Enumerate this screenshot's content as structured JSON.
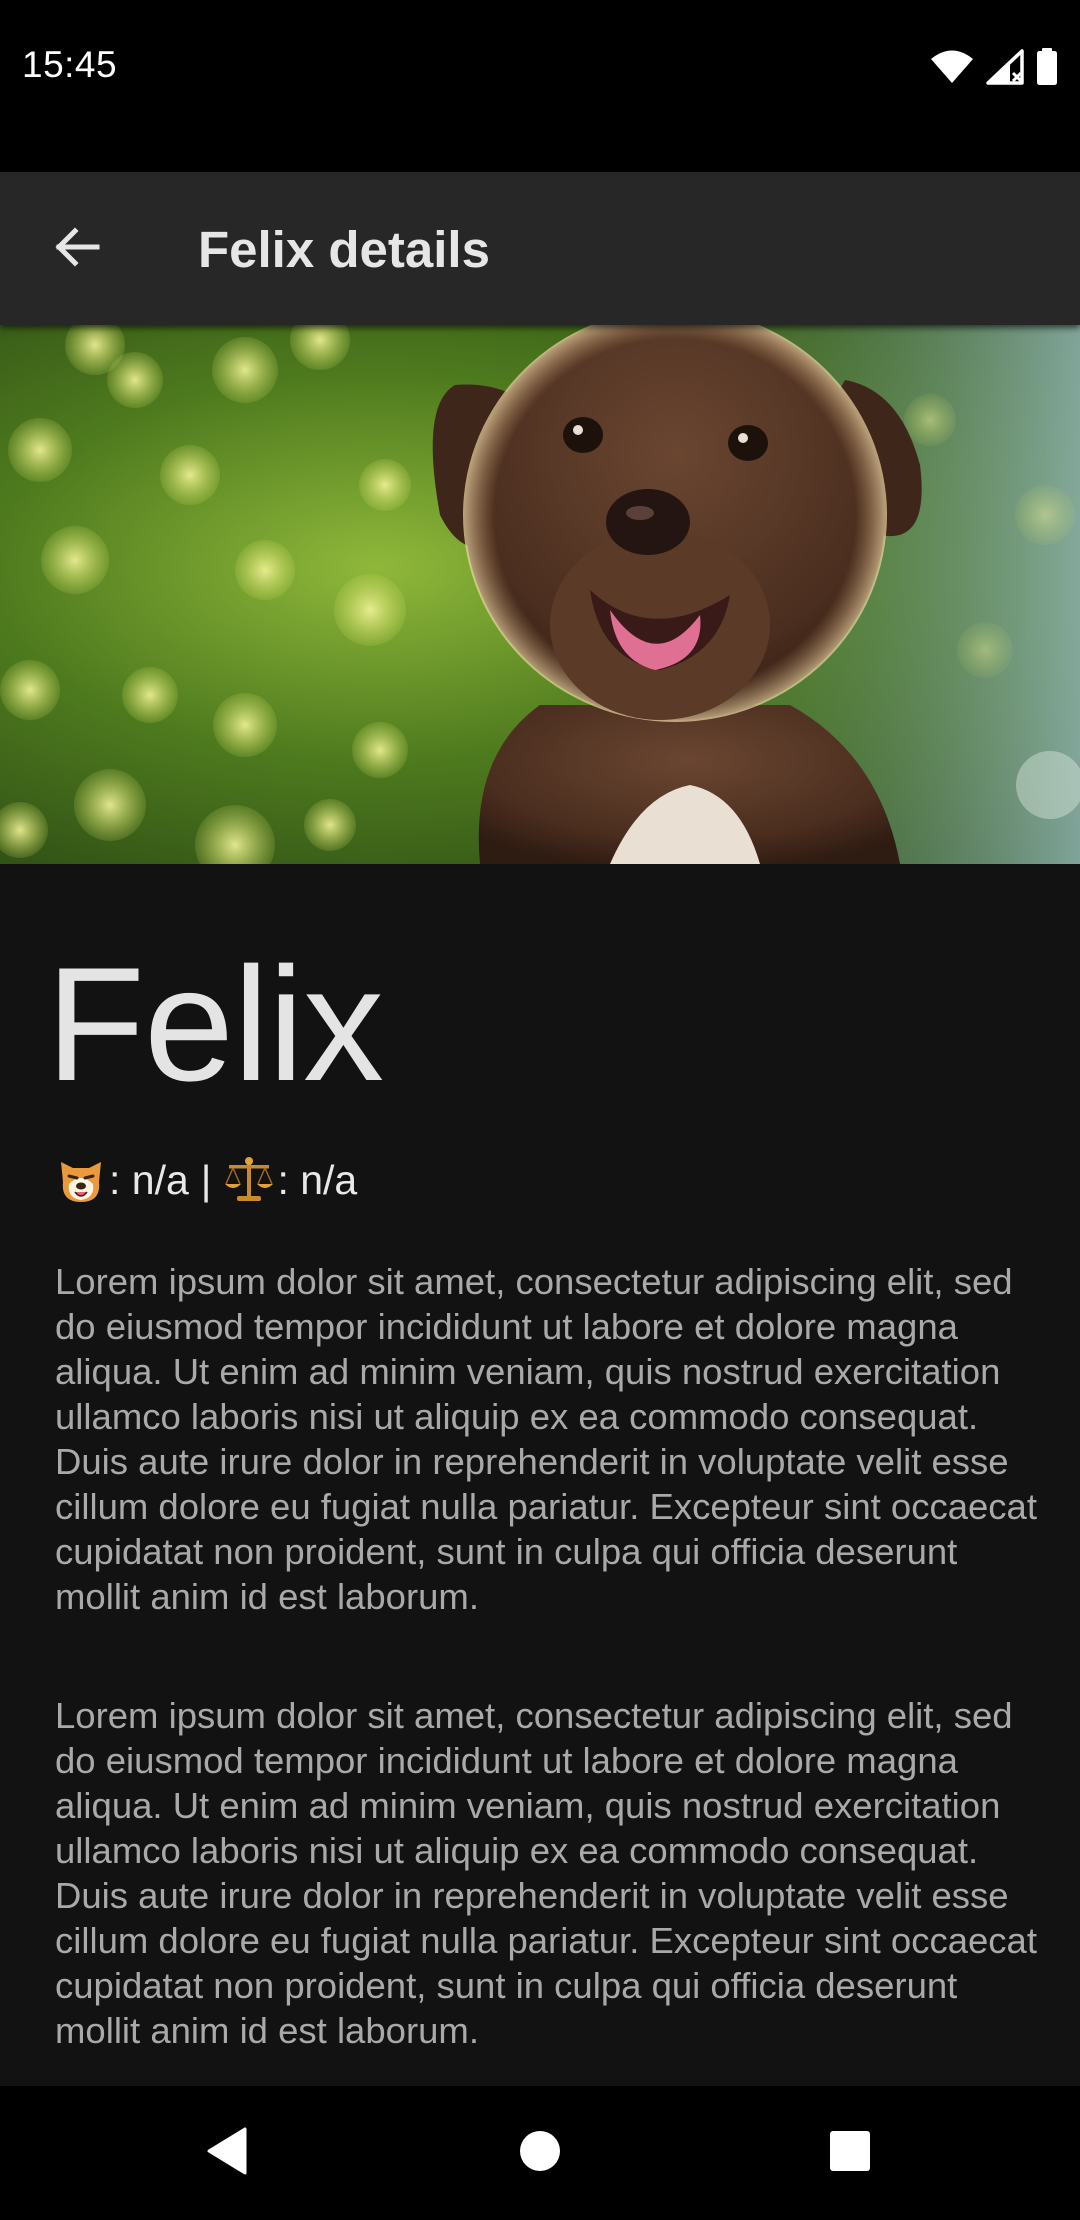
{
  "status_bar": {
    "time": "15:45",
    "icons": [
      "wifi-icon",
      "signal-icon",
      "battery-icon"
    ]
  },
  "app_bar": {
    "title": "Felix details",
    "back_icon": "arrow-left-icon"
  },
  "hero": {
    "subject": "puppy-photo"
  },
  "pet": {
    "name": "Felix",
    "age_emoji": "dog-face-icon",
    "age_value": ": n/a",
    "separator": "|",
    "weight_emoji": "scales-icon",
    "weight_value": ": n/a"
  },
  "description": {
    "paragraph_1": "Lorem ipsum dolor sit amet, consectetur adipiscing elit, sed do eiusmod tempor incididunt ut labore et dolore magna aliqua. Ut enim ad minim veniam, quis nostrud exercitation ullamco laboris nisi ut aliquip ex ea commodo consequat. Duis aute irure dolor in reprehenderit in voluptate velit esse cillum dolore eu fugiat nulla pariatur. Excepteur sint occaecat cupidatat non proident, sunt in culpa qui officia deserunt mollit anim id est laborum.",
    "paragraph_2": "Lorem ipsum dolor sit amet, consectetur adipiscing elit, sed do eiusmod tempor incididunt ut labore et dolore magna aliqua. Ut enim ad minim veniam, quis nostrud exercitation ullamco laboris nisi ut aliquip ex ea commodo consequat. Duis aute irure dolor in reprehenderit in voluptate velit esse cillum dolore eu fugiat nulla pariatur. Excepteur sint occaecat cupidatat non proident, sunt in culpa qui officia deserunt mollit anim id est laborum."
  },
  "nav_bar": {
    "back": "nav-back-icon",
    "home": "nav-home-icon",
    "recents": "nav-recents-icon"
  },
  "colors": {
    "background": "#121212",
    "app_bar": "#272727",
    "title_text": "#e6e6e6",
    "body_text": "#a9a9a9"
  }
}
